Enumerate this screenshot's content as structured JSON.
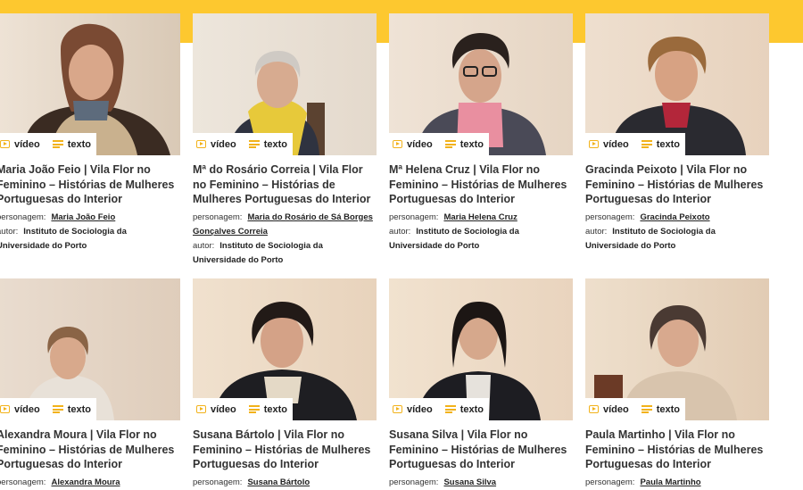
{
  "badges": {
    "video": "vídeo",
    "text": "texto"
  },
  "accent": "#fdc82f",
  "cards": [
    {
      "title": "Maria João Feio | Vila Flor no Feminino – Histórias de Mulheres Portuguesas do Interior",
      "personagem_label": "personagem:",
      "personagem": "Maria João Feio",
      "autor_label": "autor:",
      "autor": "Instituto de Sociologia da Universidade do Porto"
    },
    {
      "title": "Mª do Rosário Correia | Vila Flor no Feminino – Histórias de Mulheres Portuguesas do Interior",
      "personagem_label": "personagem:",
      "personagem": "Maria do Rosário de Sá Borges Gonçalves Correia",
      "autor_label": "autor:",
      "autor": "Instituto de Sociologia da Universidade do Porto"
    },
    {
      "title": "Mª Helena Cruz | Vila Flor no Feminino – Histórias de Mulheres Portuguesas do Interior",
      "personagem_label": "personagem:",
      "personagem": "Maria Helena Cruz",
      "autor_label": "autor:",
      "autor": "Instituto de Sociologia da Universidade do Porto"
    },
    {
      "title": "Gracinda Peixoto | Vila Flor no Feminino – Histórias de Mulheres Portuguesas do Interior",
      "personagem_label": "personagem:",
      "personagem": "Gracinda Peixoto",
      "autor_label": "autor:",
      "autor": "Instituto de Sociologia da Universidade do Porto"
    },
    {
      "title": "Alexandra Moura | Vila Flor no Feminino – Histórias de Mulheres Portuguesas do Interior",
      "personagem_label": "personagem:",
      "personagem": "Alexandra Moura"
    },
    {
      "title": "Susana Bártolo | Vila Flor no Feminino – Histórias de Mulheres Portuguesas do Interior",
      "personagem_label": "personagem:",
      "personagem": "Susana Bártolo"
    },
    {
      "title": "Susana Silva | Vila Flor no Feminino – Histórias de Mulheres Portuguesas do Interior",
      "personagem_label": "personagem:",
      "personagem": "Susana Silva"
    },
    {
      "title": "Paula Martinho | Vila Flor no Feminino – Histórias de Mulheres Portuguesas do Interior",
      "personagem_label": "personagem:",
      "personagem": "Paula Martinho"
    }
  ]
}
